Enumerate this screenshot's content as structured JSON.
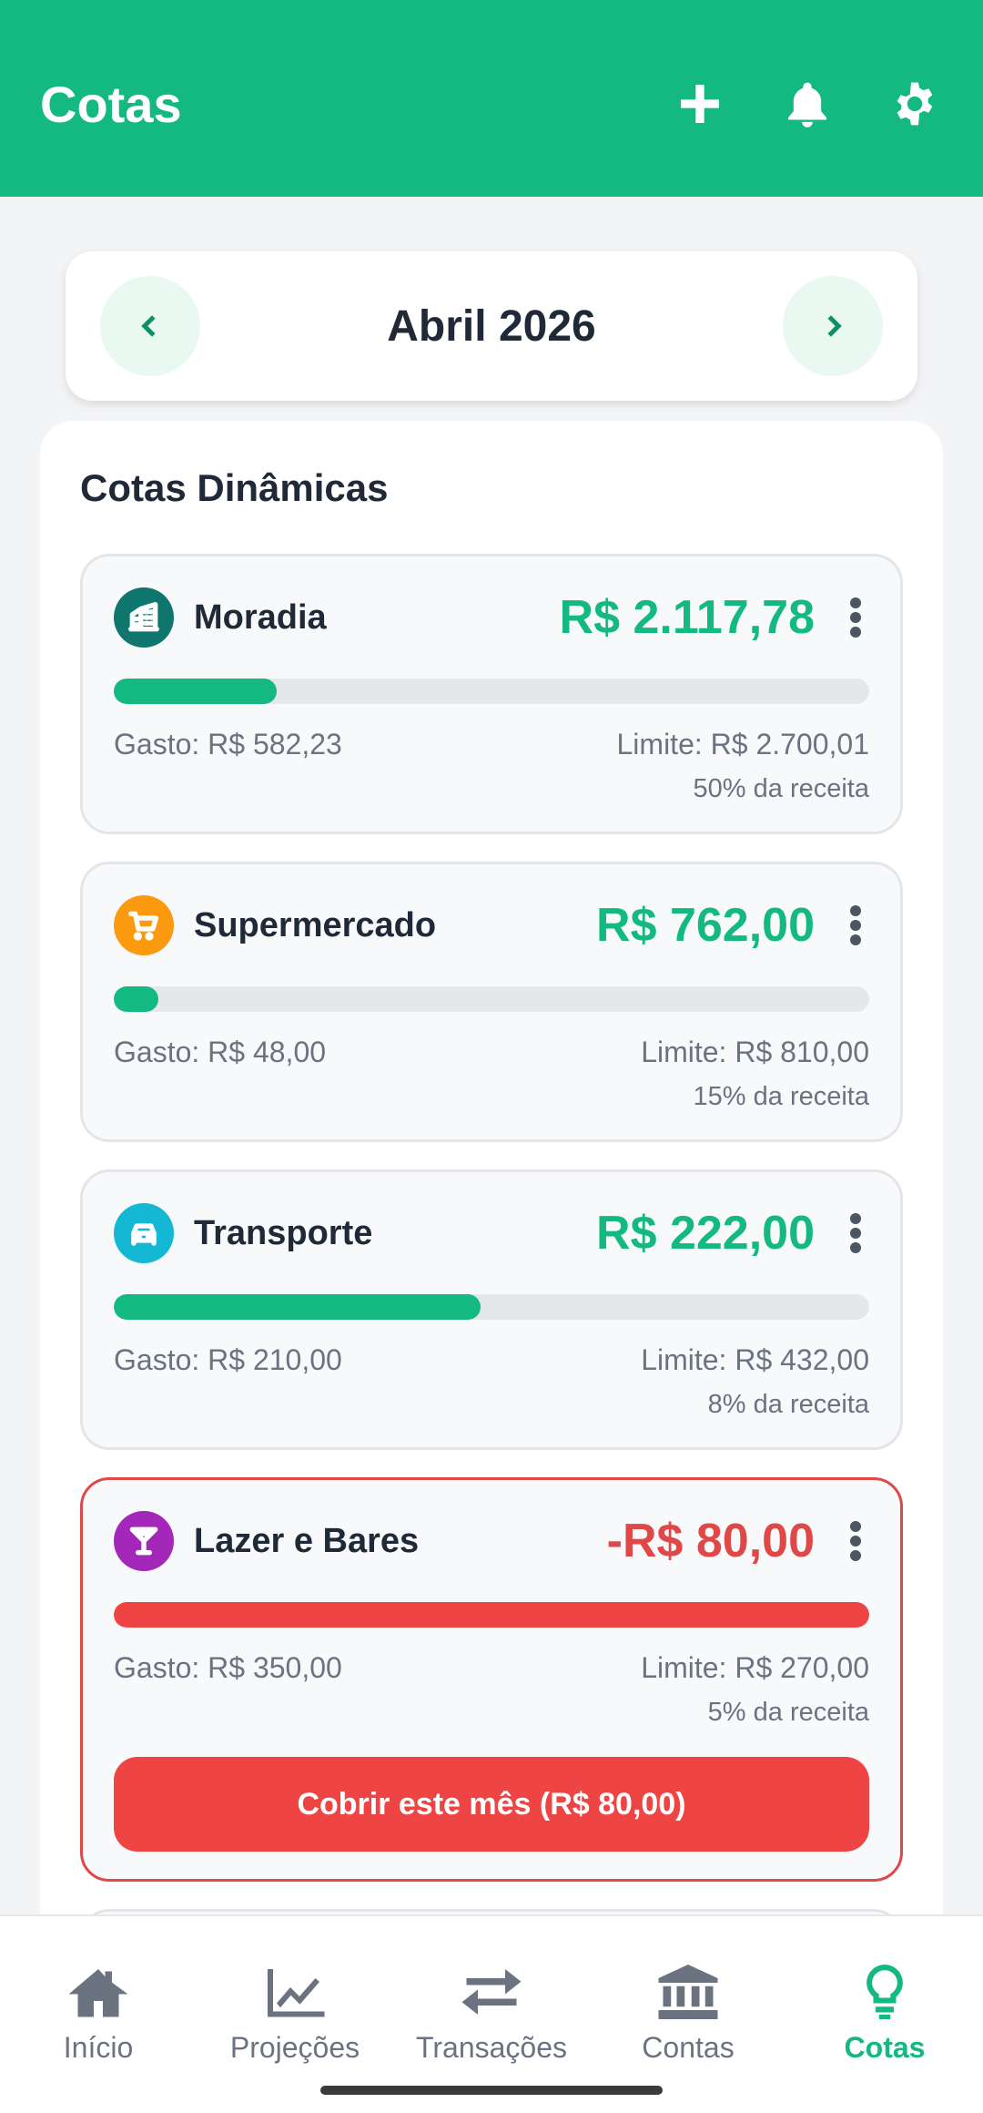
{
  "header": {
    "title": "Cotas"
  },
  "month": {
    "label": "Abril 2026"
  },
  "section": {
    "title": "Cotas Dinâmicas"
  },
  "quotas": [
    {
      "name": "Moradia",
      "amount": "R$ 2.117,78",
      "spent": "Gasto: R$ 582,23",
      "limit": "Limite: R$ 2.700,01",
      "share": "50% da receita",
      "progress": 0.216,
      "icon": "building-icon",
      "color": "#0f766e",
      "status": "ok"
    },
    {
      "name": "Supermercado",
      "amount": "R$ 762,00",
      "spent": "Gasto: R$ 48,00",
      "limit": "Limite: R$ 810,00",
      "share": "15% da receita",
      "progress": 0.059,
      "icon": "cart-icon",
      "color": "#fb9a0e",
      "status": "ok"
    },
    {
      "name": "Transporte",
      "amount": "R$ 222,00",
      "spent": "Gasto: R$ 210,00",
      "limit": "Limite: R$ 432,00",
      "share": "8% da receita",
      "progress": 0.486,
      "icon": "car-icon",
      "color": "#14b8d4",
      "status": "ok"
    },
    {
      "name": "Lazer e Bares",
      "amount": "-R$ 80,00",
      "spent": "Gasto: R$ 350,00",
      "limit": "Limite: R$ 270,00",
      "share": "5% da receita",
      "progress": 1.0,
      "icon": "cocktail-icon",
      "color": "#a327b8",
      "status": "over",
      "cover_label": "Cobrir este mês (R$ 80,00)"
    }
  ],
  "nav": [
    {
      "label": "Início",
      "icon": "home-icon",
      "active": false
    },
    {
      "label": "Projeções",
      "icon": "chart-line-icon",
      "active": false
    },
    {
      "label": "Transações",
      "icon": "transfer-icon",
      "active": false
    },
    {
      "label": "Contas",
      "icon": "bank-icon",
      "active": false
    },
    {
      "label": "Cotas",
      "icon": "lightbulb-icon",
      "active": true
    }
  ],
  "colors": {
    "brand": "#13b981",
    "danger": "#ef4444"
  }
}
